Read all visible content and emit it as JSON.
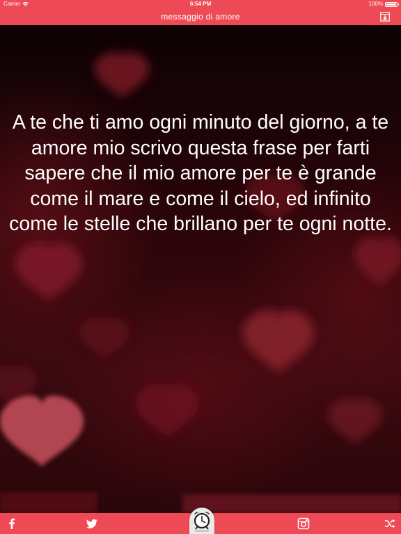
{
  "status_bar": {
    "carrier": "Carrier",
    "time": "6:54 PM",
    "battery": "100%",
    "battery_level": 1.0
  },
  "nav_bar": {
    "title": "messaggio di amore",
    "action_icon": "download-image-icon"
  },
  "quote": {
    "text": "A te che ti amo ogni minuto del giorno, a te amore mio scrivo questa frase per farti sapere che il mio amore per te è grande come il mare e come il cielo, ed infinito come le stelle che brillano per te ogni notte."
  },
  "toolbar": {
    "items": [
      {
        "name": "facebook-share-button",
        "icon": "facebook-icon"
      },
      {
        "name": "twitter-share-button",
        "icon": "twitter-icon"
      },
      {
        "name": "alarm-clock-button",
        "icon": "alarm-clock-icon"
      },
      {
        "name": "instagram-share-button",
        "icon": "instagram-icon"
      },
      {
        "name": "shuffle-button",
        "icon": "shuffle-icon"
      }
    ]
  },
  "colors": {
    "accent": "#ee4a55",
    "text": "#ffffff",
    "background_dark": "#1a0507"
  }
}
